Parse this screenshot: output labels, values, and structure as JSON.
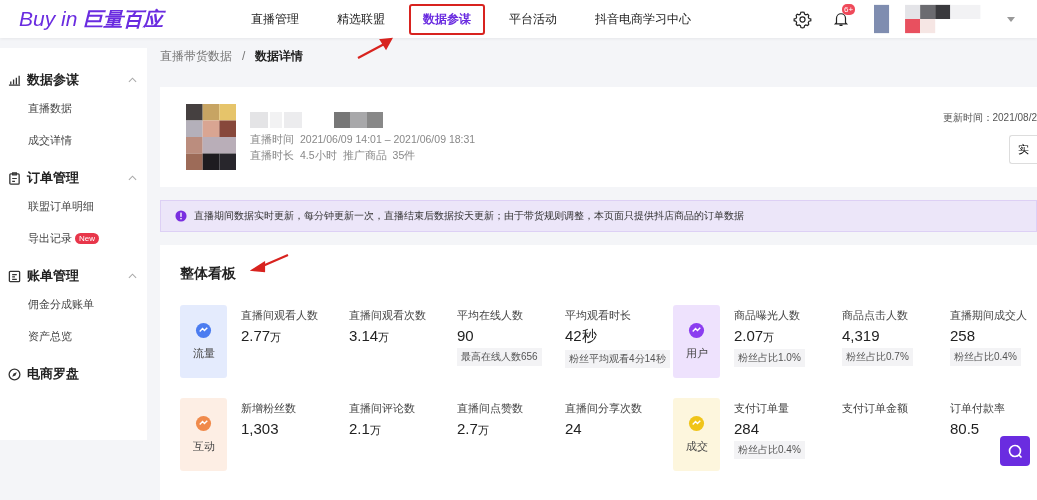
{
  "header": {
    "logo_latin": "Buy in",
    "logo_cjk": "巨量百应",
    "nav": [
      {
        "label": "直播管理",
        "selected": false,
        "highlighted": false
      },
      {
        "label": "精选联盟",
        "selected": false,
        "highlighted": false
      },
      {
        "label": "数据参谋",
        "selected": true,
        "highlighted": true
      },
      {
        "label": "平台活动",
        "selected": false,
        "highlighted": false
      },
      {
        "label": "抖音电商学习中心",
        "selected": false,
        "highlighted": false
      }
    ],
    "notification_badge": "6+"
  },
  "sidebar": [
    {
      "title": "数据参谋",
      "expanded": true,
      "children": [
        {
          "label": "直播数据"
        },
        {
          "label": "成交详情"
        }
      ]
    },
    {
      "title": "订单管理",
      "expanded": true,
      "children": [
        {
          "label": "联盟订单明细"
        },
        {
          "label": "导出记录",
          "badge": "New"
        }
      ]
    },
    {
      "title": "账单管理",
      "expanded": true,
      "children": [
        {
          "label": "佣金分成账单"
        },
        {
          "label": "资产总览"
        }
      ]
    },
    {
      "title": "电商罗盘"
    }
  ],
  "breadcrumb": [
    {
      "label": "直播带货数据",
      "selected": false
    },
    {
      "label": "数据详情",
      "selected": true
    }
  ],
  "breadcrumb_separator": "/",
  "live_card": {
    "time_label": "直播时间",
    "time_value": "2021/06/09 14:01 – 2021/06/09 18:31",
    "duration_label": "直播时长",
    "duration_value": "4.5小时",
    "products_label": "推广商品",
    "products_value": "35件",
    "updated": "更新时间：2021/08/2",
    "button": "实"
  },
  "notice": "直播期间数据实时更新，每分钟更新一次，直播结束后数据按天更新；由于带货规则调整，本页面只提供抖店商品的订单数据",
  "dashboard": {
    "title": "整体看板",
    "rows": [
      [
        {
          "label": "流量",
          "color": "#4b7cf0",
          "metrics": [
            {
              "label": "直播间观看人数",
              "value": "2.77",
              "unit": "万"
            },
            {
              "label": "直播间观看次数",
              "value": "3.14",
              "unit": "万"
            },
            {
              "label": "平均在线人数",
              "value": "90",
              "note": "最高在线人数656"
            },
            {
              "label": "平均观看时长",
              "value": "42秒",
              "note": "粉丝平均观看4分14秒"
            }
          ]
        },
        {
          "label": "用户",
          "color": "#8b3df0",
          "metrics": [
            {
              "label": "商品曝光人数",
              "value": "2.07",
              "unit": "万",
              "note": "粉丝占比1.0%"
            },
            {
              "label": "商品点击人数",
              "value": "4,319",
              "note": "粉丝占比0.7%"
            },
            {
              "label": "直播期间成交人",
              "value": "258",
              "note": "粉丝占比0.4%"
            }
          ]
        }
      ],
      [
        {
          "label": "互动",
          "color": "#f08a4b",
          "metrics": [
            {
              "label": "新增粉丝数",
              "value": "1,303"
            },
            {
              "label": "直播间评论数",
              "value": "2.1",
              "unit": "万"
            },
            {
              "label": "直播间点赞数",
              "value": "2.7",
              "unit": "万"
            },
            {
              "label": "直播间分享次数",
              "value": "24"
            }
          ]
        },
        {
          "label": "成交",
          "color": "#f0c419",
          "metrics": [
            {
              "label": "支付订单量",
              "value": "284",
              "note": "粉丝占比0.4%"
            },
            {
              "label": "支付订单金额"
            },
            {
              "label": "订单付款率",
              "value": "80.5"
            }
          ]
        }
      ]
    ]
  },
  "annotation_arrows": {
    "nav": true,
    "dashboard_title": true
  }
}
